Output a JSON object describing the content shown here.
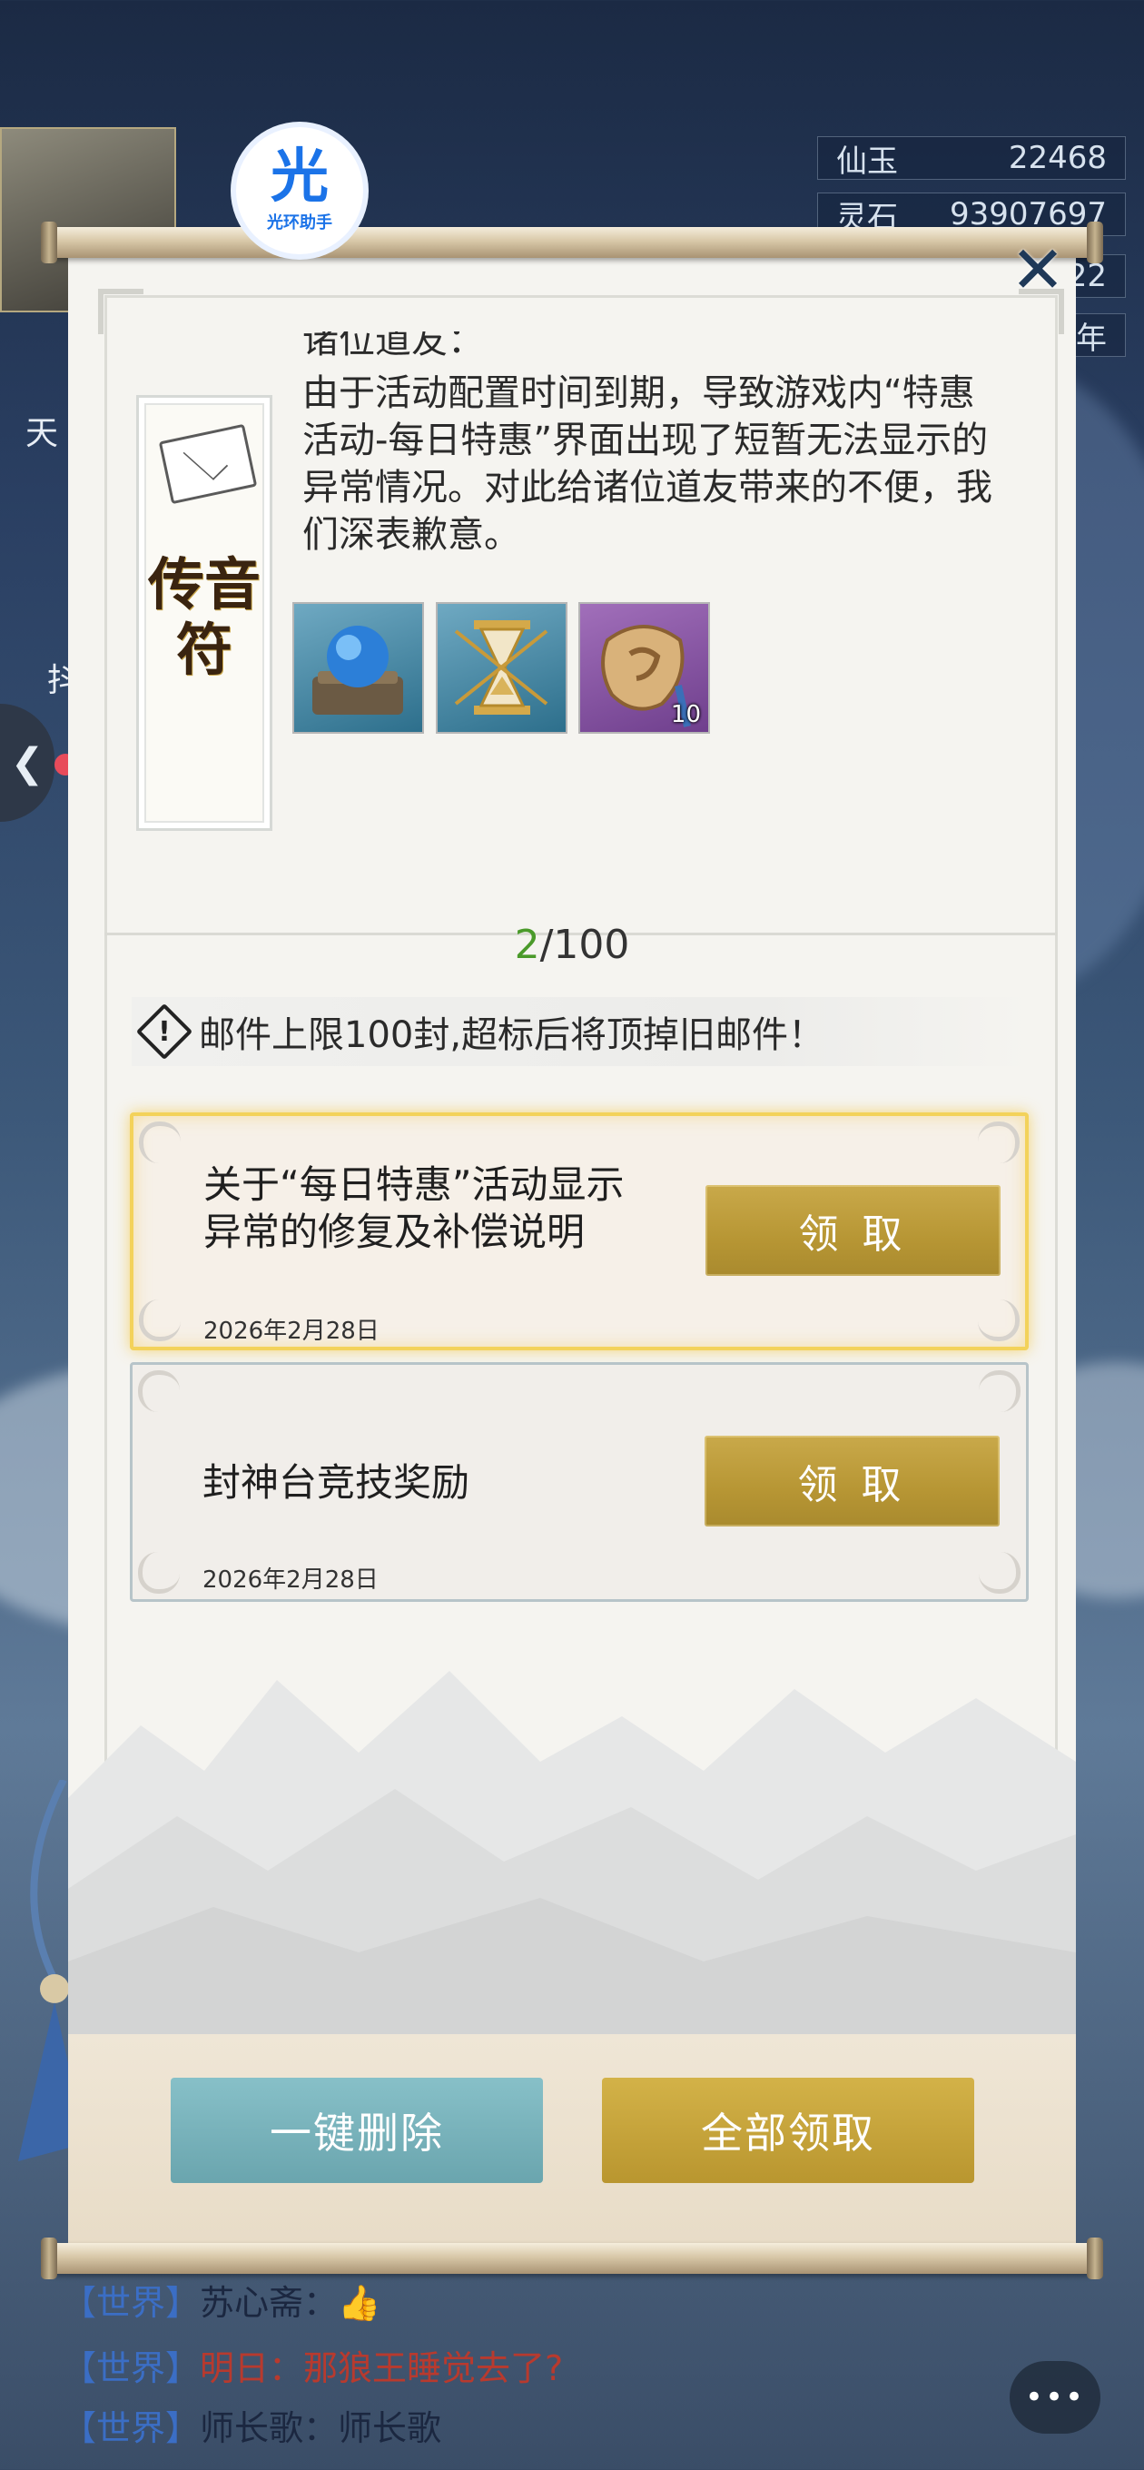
{
  "hud": {
    "xianyu_label": "仙玉",
    "xianyu_value": "22468",
    "lingshi_label": "灵石",
    "lingshi_value": "93907697",
    "row3_value": "22",
    "row4_value": "年"
  },
  "badge": {
    "glyph": "光",
    "label": "光环助手"
  },
  "side_labels": {
    "left_1": "天",
    "left_2": "抖"
  },
  "talisman": {
    "title": "传音符"
  },
  "letter": {
    "greeting": "诸位道友：",
    "body": "由于活动配置时间到期，导致游戏内“特惠活动-每日特惠”界面出现了短暂无法显示的异常情况。对此给诸位道友带来的不便，我们深表歉意。"
  },
  "items": [
    {
      "icon": "blue-orb-icon",
      "count": ""
    },
    {
      "icon": "hourglass-icon",
      "count": ""
    },
    {
      "icon": "token-icon",
      "count": "10"
    }
  ],
  "mailbox": {
    "count_current": "2",
    "count_total": "/100",
    "notice": "邮件上限100封,超标后将顶掉旧邮件！"
  },
  "mails": [
    {
      "title": "关于“每日特惠”活动显示异常的修复及补偿说明",
      "date": "2026年2月28日",
      "button": "领 取"
    },
    {
      "title": "封神台竞技奖励",
      "date": "2026年2月28日",
      "button": "领 取"
    }
  ],
  "actions": {
    "delete_all": "一键删除",
    "claim_all": "全部领取"
  },
  "chat": [
    {
      "channel": "【世界】",
      "name": "苏心斋：",
      "message": "👍"
    },
    {
      "channel": "【世界】",
      "name": "明日：",
      "message": "那狼王睡觉去了?"
    },
    {
      "channel": "【世界】",
      "name": "师长歌：",
      "message": "师长歌"
    }
  ],
  "chat_button": "•••",
  "colors": {
    "gold_button": "#b79634",
    "teal_button": "#6aa5ae",
    "highlight_border": "#f3d25a",
    "counter_green": "#4a9a2a",
    "chat_channel": "#3b6ec5"
  }
}
